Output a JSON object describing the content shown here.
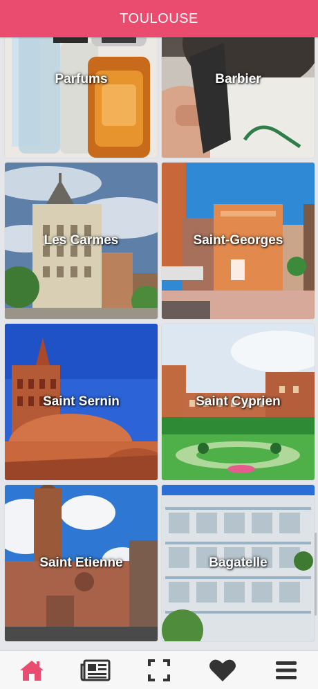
{
  "header": {
    "title": "TOULOUSE"
  },
  "tiles": [
    {
      "label": "Parfums",
      "icon": "perfume-photo"
    },
    {
      "label": "Barbier",
      "icon": "barber-photo"
    },
    {
      "label": "Les Carmes",
      "icon": "les-carmes-photo"
    },
    {
      "label": "Saint-Georges",
      "icon": "saint-georges-photo"
    },
    {
      "label": "Saint Sernin",
      "icon": "saint-sernin-photo"
    },
    {
      "label": "Saint Cyprien",
      "icon": "saint-cyprien-photo"
    },
    {
      "label": "Saint Etienne",
      "icon": "saint-etienne-photo"
    },
    {
      "label": "Bagatelle",
      "icon": "bagatelle-photo"
    }
  ],
  "tabbar": {
    "items": [
      {
        "icon": "home-icon",
        "active": true
      },
      {
        "icon": "newspaper-icon",
        "active": false
      },
      {
        "icon": "scan-icon",
        "active": false
      },
      {
        "icon": "heart-icon",
        "active": false
      },
      {
        "icon": "menu-icon",
        "active": false
      }
    ]
  },
  "colors": {
    "accent": "#e94c6e",
    "icon": "#333333",
    "active_icon": "#e94c6e"
  }
}
